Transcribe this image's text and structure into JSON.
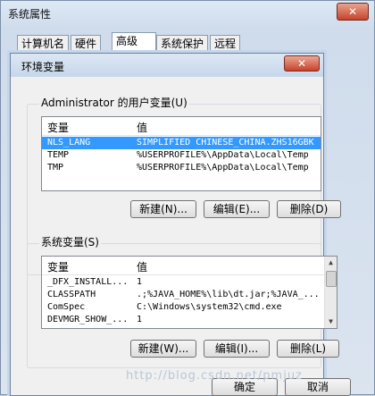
{
  "system_properties": {
    "title": "系统属性",
    "close_label": "✕",
    "tabs": [
      {
        "label": "计算机名"
      },
      {
        "label": "硬件"
      },
      {
        "label": "高级"
      },
      {
        "label": "系统保护"
      },
      {
        "label": "远程"
      }
    ],
    "ok_label": "确定",
    "cancel_label": "取消"
  },
  "env_dialog": {
    "title": "环境变量",
    "close_label": "✕",
    "user_vars": {
      "group_label": "Administrator 的用户变量(U)",
      "columns": [
        "变量",
        "值"
      ],
      "rows": [
        {
          "name": "NLS_LANG",
          "value": "SIMPLIFIED CHINESE_CHINA.ZHS16GBK",
          "selected": true
        },
        {
          "name": "TEMP",
          "value": "%USERPROFILE%\\AppData\\Local\\Temp"
        },
        {
          "name": "TMP",
          "value": "%USERPROFILE%\\AppData\\Local\\Temp"
        }
      ],
      "new_label": "新建(N)...",
      "edit_label": "编辑(E)...",
      "delete_label": "删除(D)"
    },
    "system_vars": {
      "group_label": "系统变量(S)",
      "columns": [
        "变量",
        "值"
      ],
      "rows": [
        {
          "name": "_DFX_INSTALL...",
          "value": "1"
        },
        {
          "name": "CLASSPATH",
          "value": ".;%JAVA_HOME%\\lib\\dt.jar;%JAVA_..."
        },
        {
          "name": "ComSpec",
          "value": "C:\\Windows\\system32\\cmd.exe"
        },
        {
          "name": "DEVMGR_SHOW_...",
          "value": "1"
        }
      ],
      "new_label": "新建(W)...",
      "edit_label": "编辑(I)...",
      "delete_label": "删除(L)"
    }
  },
  "watermark": "http://blog.csdn.net/pmjuz",
  "colors": {
    "selection": "#3399ff",
    "accent": "#c7412a"
  }
}
